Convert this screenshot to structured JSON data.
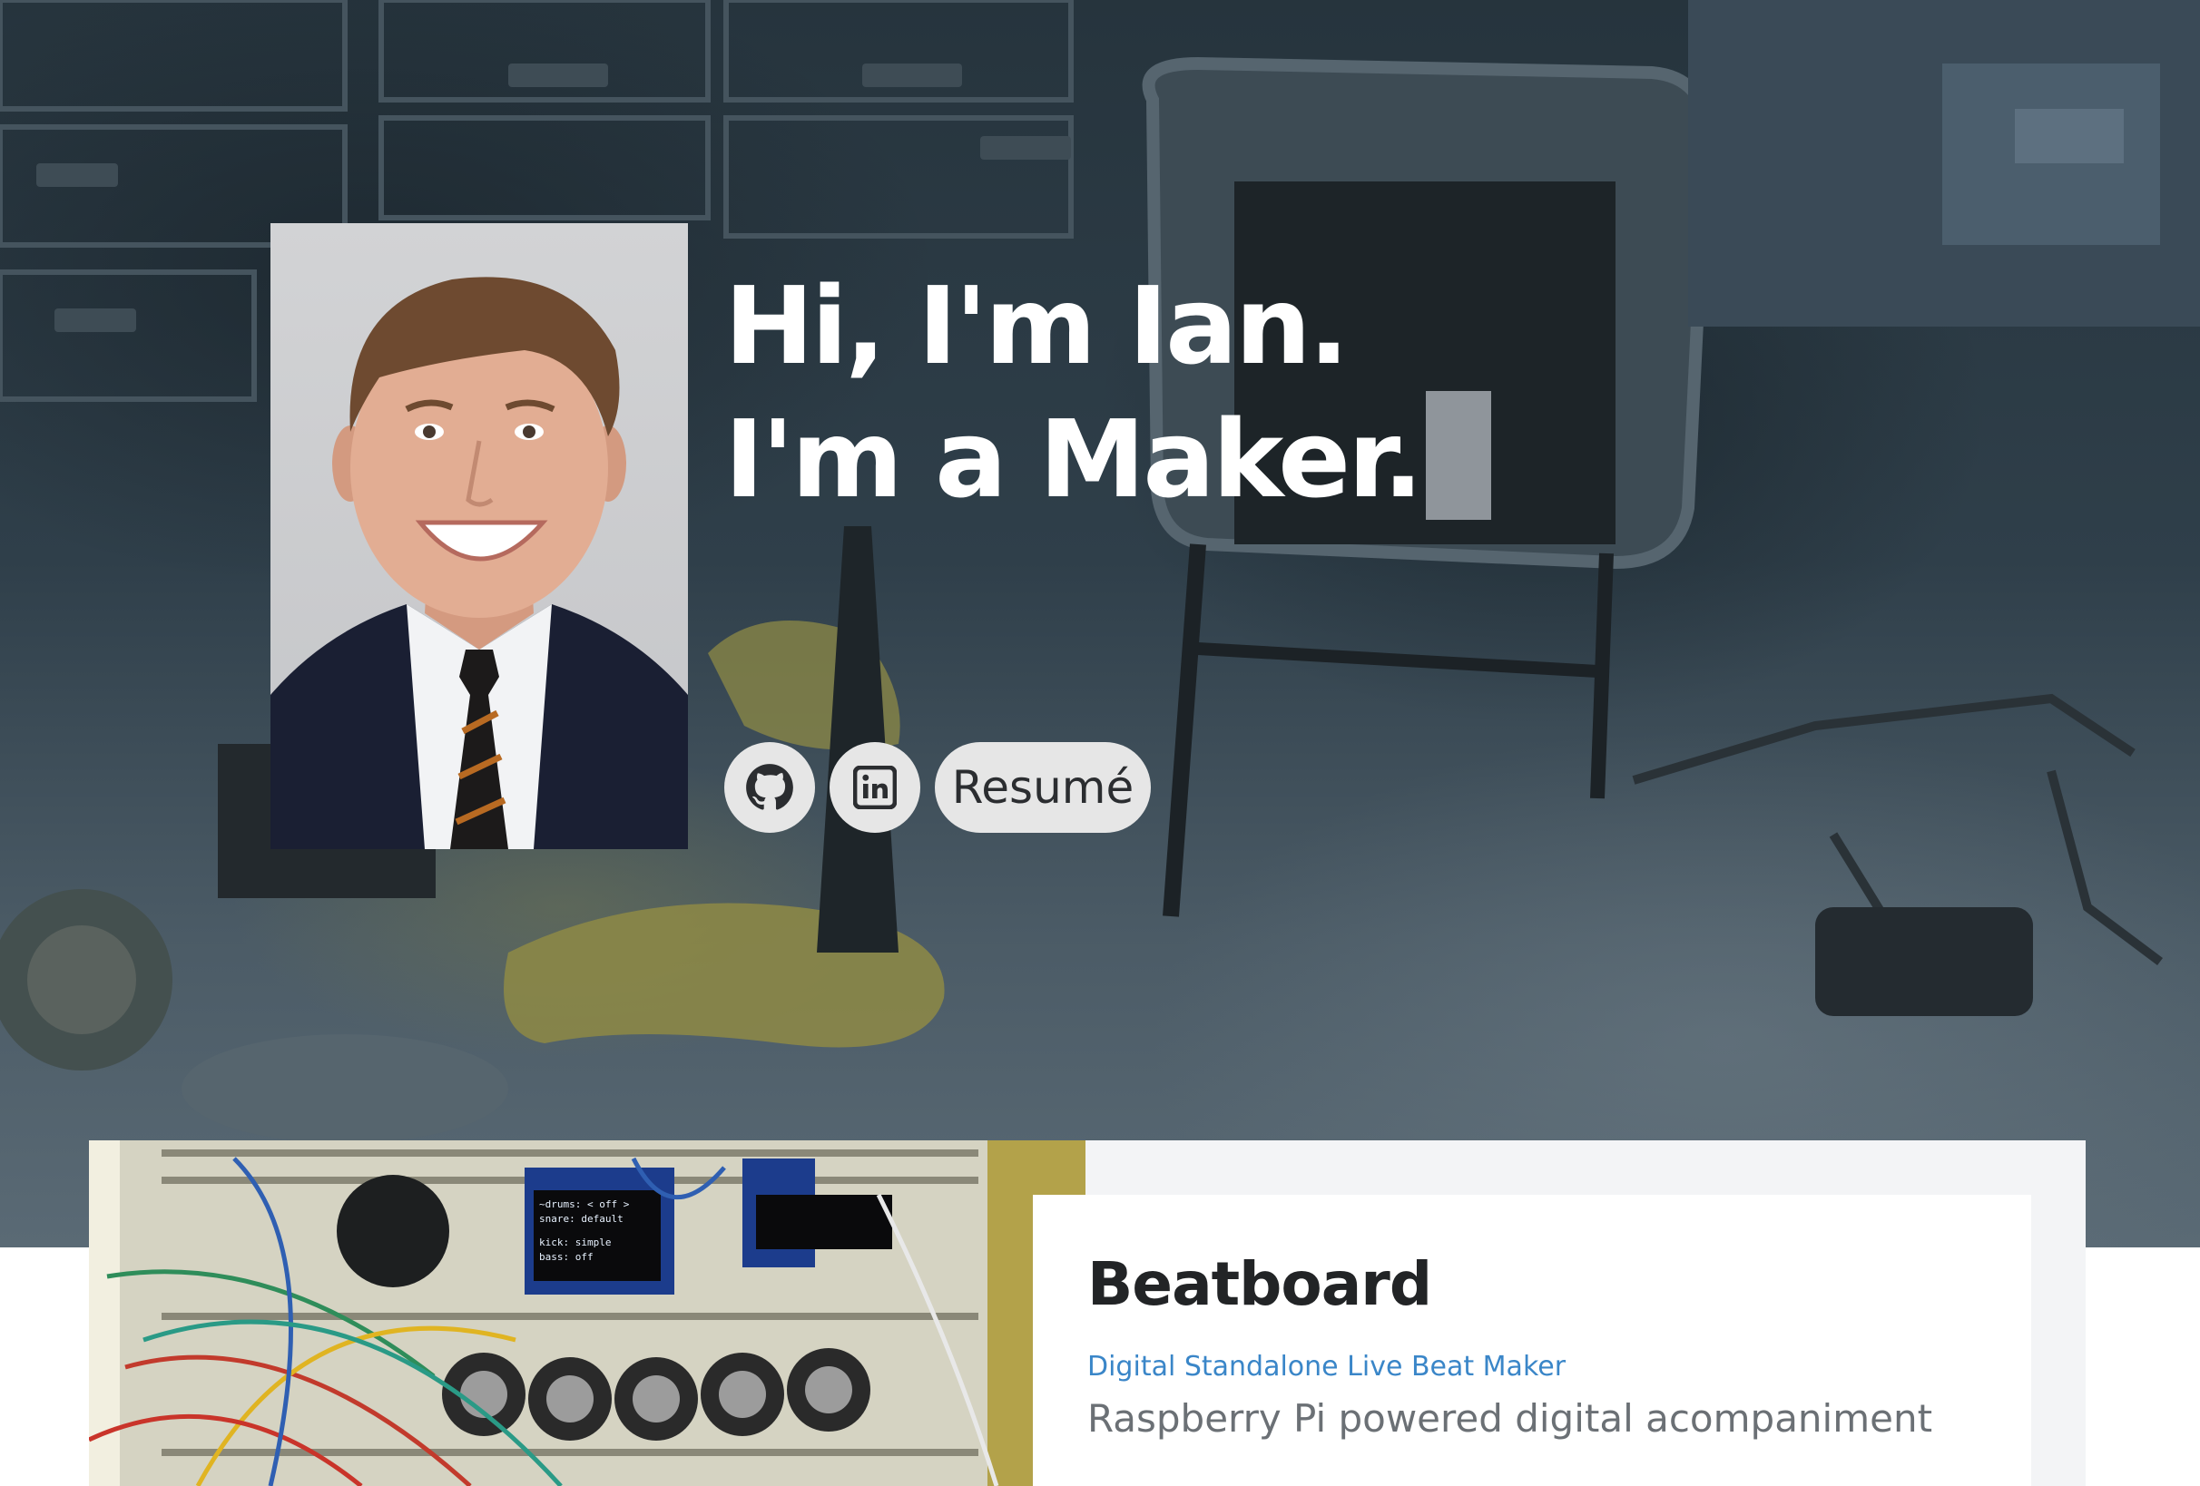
{
  "hero": {
    "greeting": "Hi, I'm Ian.",
    "tagline": "I'm a Maker.",
    "portrait_alt": "Portrait of Ian"
  },
  "social": {
    "github_icon": "github-icon",
    "linkedin_icon": "linkedin-icon",
    "resume_label": "Resumé"
  },
  "project": {
    "title": "Beatboard",
    "subtitle": "Digital Standalone Live Beat Maker",
    "description": "Raspberry Pi powered digital acompaniment",
    "screen_lines": [
      "~drums: < off >",
      "snare: default",
      "",
      "kick: simple",
      "bass: off"
    ]
  },
  "colors": {
    "hero_overlay": "#2f3f4a",
    "button_bg": "#e6e6e6",
    "subtitle_link": "#3a86c8",
    "card_bg": "#f3f4f6"
  }
}
